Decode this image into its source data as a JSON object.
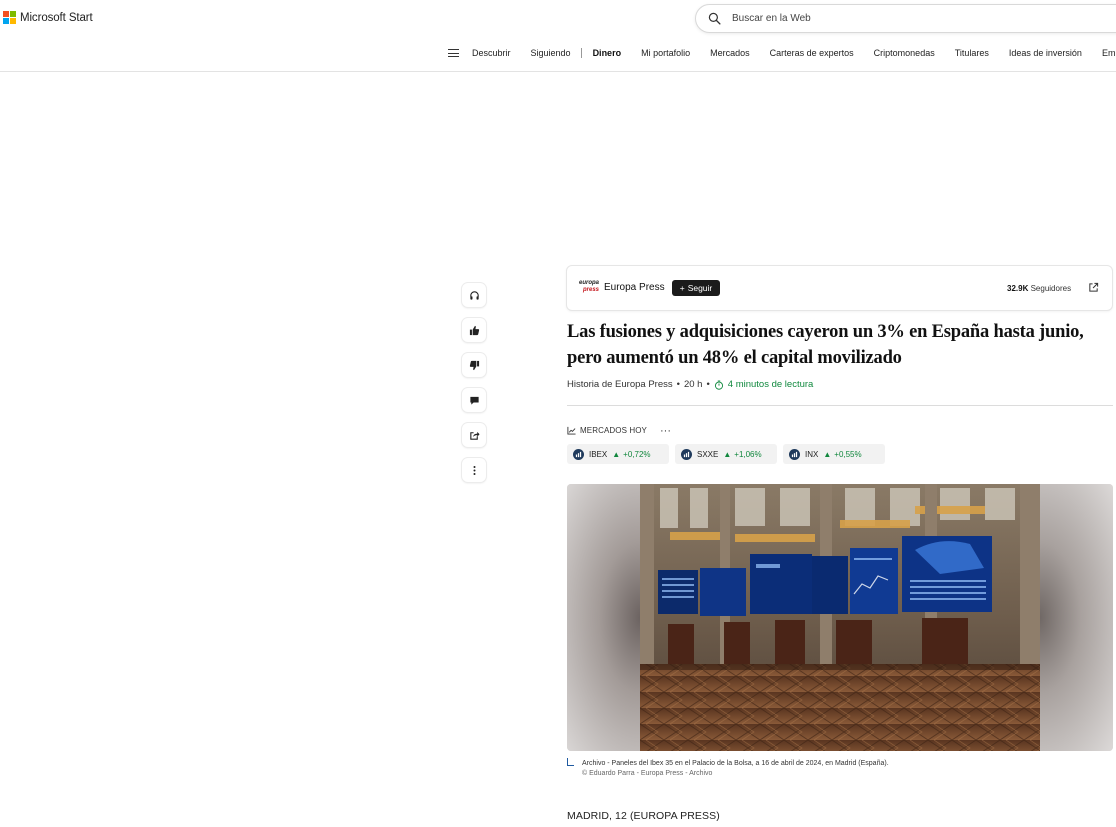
{
  "brand": {
    "name": "Microsoft Start",
    "colors": [
      "#f25022",
      "#7fba00",
      "#00a4ef",
      "#ffb900"
    ]
  },
  "search": {
    "placeholder": "Buscar en la Web"
  },
  "nav": {
    "items": [
      "Descubrir",
      "Siguiendo",
      "Dinero",
      "Mi portafolio",
      "Mercados",
      "Carteras de expertos",
      "Criptomonedas",
      "Titulares",
      "Ideas de inversión",
      "Empresas"
    ],
    "active": "Dinero"
  },
  "side_actions": [
    "headphones-icon",
    "thumbs-up-icon",
    "thumbs-down-icon",
    "comment-icon",
    "share-icon",
    "more-vertical-icon"
  ],
  "publisher": {
    "logo_line1": "europa",
    "logo_line2": "press",
    "name": "Europa Press",
    "follow_label": "Seguir",
    "followers_count": "32.9K",
    "followers_label": "Seguidores"
  },
  "article": {
    "headline": "Las fusiones y adquisiciones cayeron un 3% en España hasta junio, pero aumentó un 48% el capital movilizado",
    "byline_source": "Historia de Europa Press",
    "byline_time": "20 h",
    "read_time": "4 minutos de lectura",
    "dateline": "MADRID, 12 (EUROPA PRESS)"
  },
  "markets": {
    "title": "MERCADOS HOY",
    "tickers": [
      {
        "symbol": "IBEX",
        "change": "+0,72%"
      },
      {
        "symbol": "SXXE",
        "change": "+1,06%"
      },
      {
        "symbol": "INX",
        "change": "+0,55%"
      }
    ],
    "up_color": "#11873d"
  },
  "image": {
    "caption": "Archivo - Paneles del Ibex 35 en el Palacio de la Bolsa, a 16 de abril de 2024, en Madrid (España).",
    "credit": "© Eduardo Parra - Europa Press - Archivo"
  }
}
